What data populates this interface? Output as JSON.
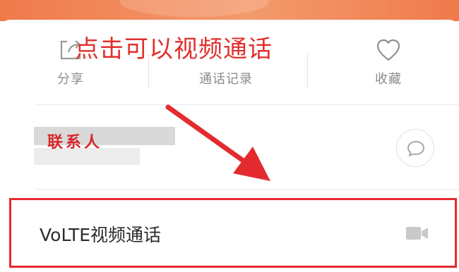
{
  "annotation_text": "点击可以视频通话",
  "actions": {
    "share": {
      "label": "分享",
      "icon": "share-icon"
    },
    "call_log": {
      "label": "通话记录"
    },
    "favorite": {
      "label": "收藏",
      "icon": "heart-icon"
    }
  },
  "contact": {
    "label": "联系人",
    "message_icon": "chat-bubble-icon"
  },
  "volte": {
    "label": "VoLTE视频通话",
    "icon": "video-camera-icon"
  },
  "colors": {
    "header": "#f07a4c",
    "annotation_red": "#e0302c",
    "highlight_border": "#e32b2f",
    "label_gray": "#8a8a8a"
  }
}
